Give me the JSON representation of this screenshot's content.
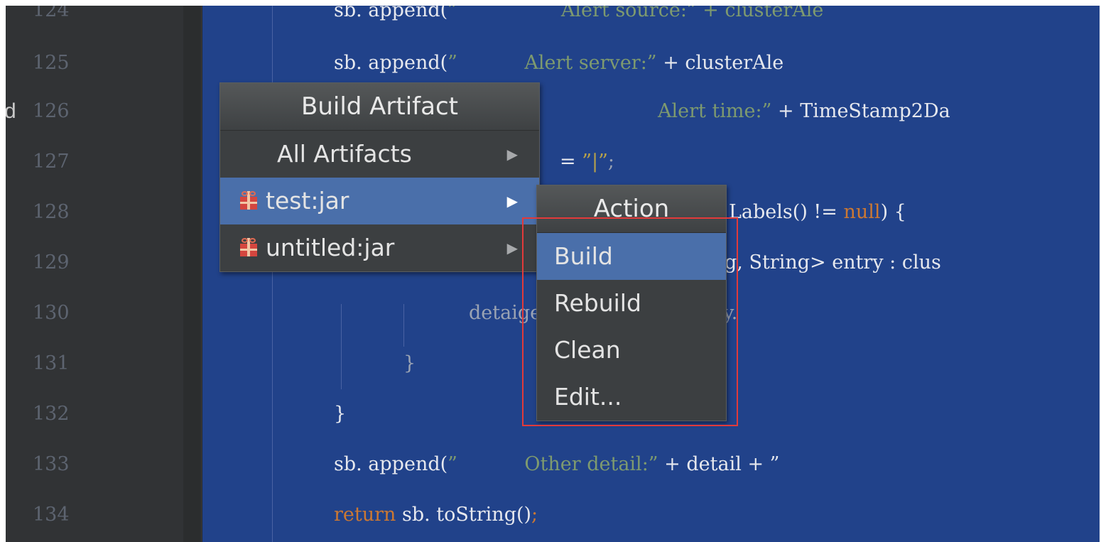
{
  "editor": {
    "gutter_marker": "d",
    "lines": [
      {
        "num": "124",
        "segments": [
          {
            "t": "sb. append(",
            "c": ""
          },
          {
            "t": "”                 Alert source:” + clusterAle",
            "c": "str"
          }
        ]
      },
      {
        "num": "125",
        "segments": [
          {
            "t": "sb. append(",
            "c": ""
          },
          {
            "t": "”           Alert server:”",
            "c": "str"
          },
          {
            "t": " + clusterAle",
            "c": ""
          }
        ]
      },
      {
        "num": "126",
        "segments": [
          {
            "t": "Alert time:”",
            "c": "str"
          },
          {
            "t": " + TimeStamp2Da",
            "c": ""
          }
        ]
      },
      {
        "num": "127",
        "segments": [
          {
            "t": "= ",
            "c": ""
          },
          {
            "t": "”|”",
            "c": "strw"
          },
          {
            "t": ";",
            "c": "gray"
          }
        ]
      },
      {
        "num": "128",
        "segments": [
          {
            "t": "Labels() != ",
            "c": ""
          },
          {
            "t": "null",
            "c": "kw"
          },
          {
            "t": ") {",
            "c": ""
          }
        ]
      },
      {
        "num": "129",
        "segments": [
          {
            "t": "g, String> entry : clus",
            "c": ""
          }
        ]
      },
      {
        "num": "130",
        "segments": [
          {
            "t": "detai",
            "c": "gray"
          },
          {
            "t": "getKey() + ",
            "c": "gray"
          },
          {
            "t": "”:”",
            "c": "strw"
          },
          {
            "t": " + entry.",
            "c": "gray"
          }
        ]
      },
      {
        "num": "131",
        "segments": [
          {
            "t": "}",
            "c": "gray"
          }
        ]
      },
      {
        "num": "132",
        "segments": [
          {
            "t": "}",
            "c": ""
          }
        ]
      },
      {
        "num": "133",
        "segments": [
          {
            "t": "sb. append(",
            "c": ""
          },
          {
            "t": "”           Other detail:”",
            "c": "str"
          },
          {
            "t": " + detail + ”",
            "c": ""
          }
        ]
      },
      {
        "num": "134",
        "segments": [
          {
            "t": "return",
            "c": "kw"
          },
          {
            "t": " sb. toString()",
            "c": ""
          },
          {
            "t": ";",
            "c": "kw"
          }
        ]
      }
    ]
  },
  "build_menu": {
    "title": "Build Artifact",
    "items": [
      {
        "label": "All Artifacts",
        "icon": "none",
        "has_submenu": true,
        "selected": false
      },
      {
        "label": "test:jar",
        "icon": "gift-jar-icon",
        "has_submenu": true,
        "selected": true
      },
      {
        "label": "untitled:jar",
        "icon": "gift-jar-icon",
        "has_submenu": true,
        "selected": false
      }
    ]
  },
  "action_menu": {
    "title": "Action",
    "items": [
      {
        "label": "Build",
        "selected": true
      },
      {
        "label": "Rebuild",
        "selected": false
      },
      {
        "label": "Clean",
        "selected": false
      },
      {
        "label": "Edit...",
        "selected": false
      }
    ]
  },
  "colors": {
    "editor_bg": "#21428a",
    "menu_bg": "#3c3f41",
    "selection": "#4a6faa",
    "highlight_border": "#e23a3a",
    "string": "#7e9a6f",
    "keyword": "#cc7832"
  }
}
